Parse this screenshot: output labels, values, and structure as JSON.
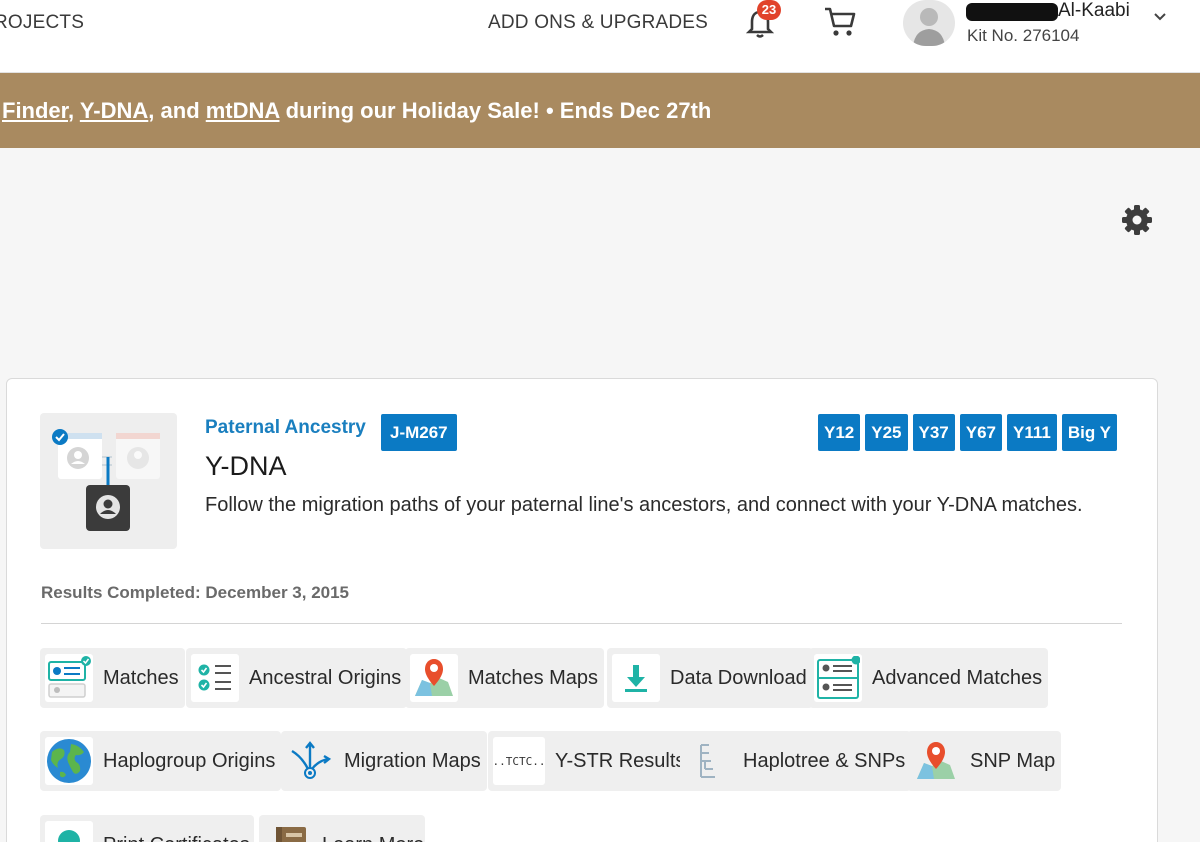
{
  "nav": {
    "projects_label": "ROJECTS",
    "addons_label": "ADD ONS & UPGRADES",
    "notification_count": "23",
    "user_name": "Al-Kaabi",
    "kit_label": "Kit No. 276104"
  },
  "banner": {
    "link_1": "Finder",
    "sep_1": ", ",
    "link_2": "Y-DNA",
    "sep_2": ", and ",
    "link_3": "mtDNA",
    "text_after": " during our Holiday Sale!  •  Ends Dec 27th",
    "color": "#a98a60"
  },
  "card": {
    "kicker": "Paternal Ancestry",
    "haplogroup": "J-M267",
    "title": "Y-DNA",
    "description": "Follow the migration paths of your paternal line's ancestors, and connect with your Y-DNA matches.",
    "tests": [
      "Y12",
      "Y25",
      "Y37",
      "Y67",
      "Y111",
      "Big Y"
    ],
    "results": "Results Completed: December 3, 2015",
    "accent": "#0b7ac4"
  },
  "tools": [
    {
      "label": "Matches",
      "icon": "matches-icon"
    },
    {
      "label": "Ancestral Origins",
      "icon": "checklist-icon"
    },
    {
      "label": "Matches Maps",
      "icon": "map-pin-icon"
    },
    {
      "label": "Data Download",
      "icon": "download-icon"
    },
    {
      "label": "Advanced Matches",
      "icon": "advanced-matches-icon"
    },
    {
      "label": "Haplogroup Origins",
      "icon": "globe-icon"
    },
    {
      "label": "Migration Maps",
      "icon": "migration-icon"
    },
    {
      "label": "Y-STR Results",
      "icon": "str-icon",
      "icon_text": "..TCTC.."
    },
    {
      "label": "Haplotree & SNPs",
      "icon": "tree-icon"
    },
    {
      "label": "SNP Map",
      "icon": "map-pin-icon"
    },
    {
      "label": "Print Certificates",
      "icon": "certificate-icon"
    },
    {
      "label": "Learn More",
      "icon": "book-icon"
    }
  ]
}
